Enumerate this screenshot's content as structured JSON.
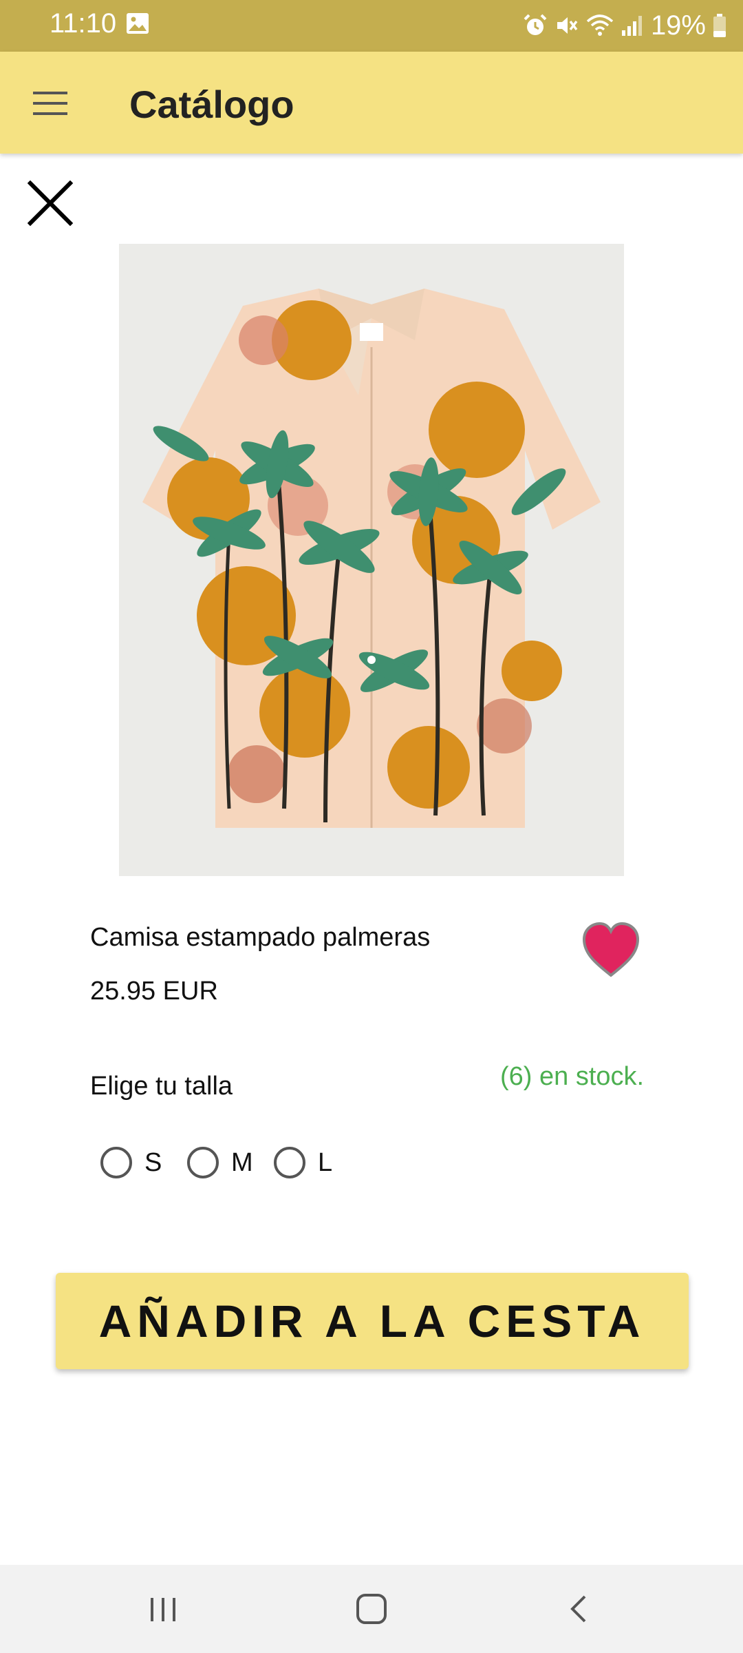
{
  "status_bar": {
    "time": "11:10",
    "battery_percent": "19%",
    "left_icons": [
      "image-icon"
    ],
    "right_icons": [
      "alarm-icon",
      "mute-icon",
      "wifi-icon",
      "signal-icon",
      "battery-icon"
    ]
  },
  "app_bar": {
    "title": "Catálogo",
    "menu_icon": "hamburger-menu-icon",
    "background_color": "#f5e283"
  },
  "product": {
    "name": "Camisa estampado palmeras",
    "price": "25.95 EUR",
    "image_alt": "shirt-image",
    "favorite": true,
    "favorite_color": "#e0245e"
  },
  "size_section": {
    "label": "Elige tu talla",
    "stock_text": "(6) en stock.",
    "stock_color": "#4caf50",
    "options": [
      {
        "label": "S",
        "selected": false
      },
      {
        "label": "M",
        "selected": false
      },
      {
        "label": "L",
        "selected": false
      }
    ]
  },
  "actions": {
    "add_to_cart_label": "AÑADIR A LA CESTA",
    "close_icon": "close-icon"
  },
  "nav_bar": {
    "buttons": [
      "recent-apps-icon",
      "home-icon",
      "back-icon"
    ]
  }
}
